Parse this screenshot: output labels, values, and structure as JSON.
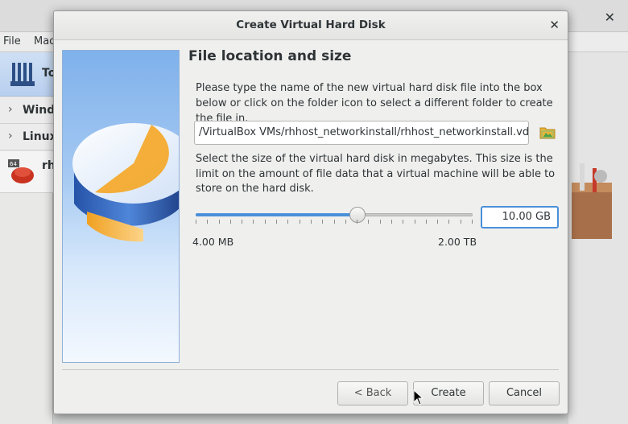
{
  "background_window": {
    "menu": [
      "File",
      "Mac"
    ],
    "groups": [
      "Windo",
      "Linux"
    ],
    "tools_label": "To",
    "vm": {
      "name": "rh",
      "badge": "64"
    }
  },
  "dialog": {
    "title": "Create Virtual Hard Disk",
    "heading": "File location and size",
    "instruction_location": "Please type the name of the new virtual hard disk file into the box below or click on the folder icon to select a different folder to create the file in.",
    "file_path": "/VirtualBox VMs/rhhost_networkinstall/rhhost_networkinstall.vdi",
    "instruction_size": "Select the size of the virtual hard disk in megabytes. This size is the limit on the amount of file data that a virtual machine will be able to store on the hard disk.",
    "size_value": "10.00 GB",
    "size_slider_fraction": 0.585,
    "range_min": "4.00 MB",
    "range_max": "2.00 TB",
    "buttons": {
      "back": "< Back",
      "create": "Create",
      "cancel": "Cancel"
    }
  },
  "colors": {
    "accent": "#4a90d9",
    "dialog_bg": "#efefee"
  },
  "icons": [
    "close-icon",
    "folder-icon",
    "disk-illustration",
    "mouse-cursor-icon",
    "chevron-right-icon",
    "toolbox-icon"
  ]
}
